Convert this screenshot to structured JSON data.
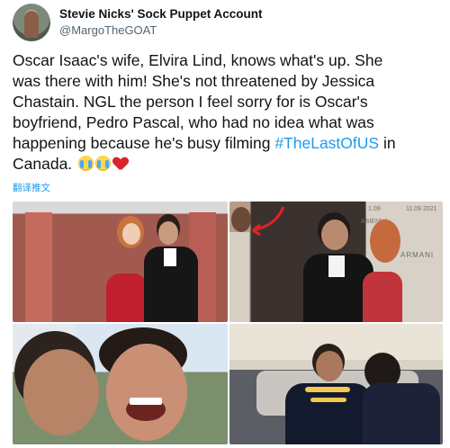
{
  "author": {
    "name": "Stevie Nicks' Sock Puppet Account",
    "handle": "@MargoTheGOAT"
  },
  "tweet": {
    "lines": [
      "Oscar Isaac's wife, Elvira Lind, knows what's up. She",
      "was there with him! She's not threatened by Jessica",
      "Chastain. NGL the person I feel sorry for is Oscar's",
      "boyfriend, Pedro Pascal, who had no idea what was",
      "happening because he's busy filming "
    ],
    "hashtag": "#TheLastOfUS",
    "after_hashtag": " in",
    "last_line": "Canada.",
    "emojis": [
      "loudly-crying-face",
      "loudly-crying-face",
      "broken-heart"
    ]
  },
  "translate_label": "翻译推文",
  "photo2_backdrop": {
    "date_left": "1.09",
    "date_right": "11.09 2021",
    "event_fragment": "ABIENNA",
    "brand": "ARMANI"
  },
  "colors": {
    "link": "#1d9bf0",
    "text": "#0f1419",
    "secondary": "#536471"
  }
}
